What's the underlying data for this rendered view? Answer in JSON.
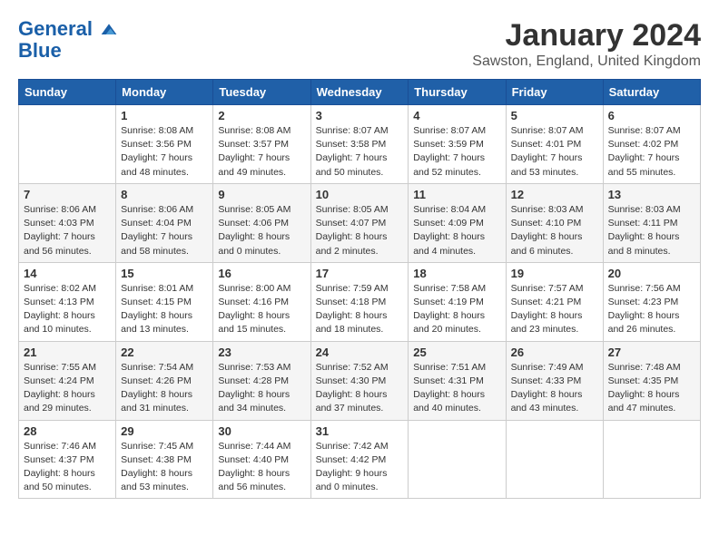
{
  "header": {
    "logo_line1": "General",
    "logo_line2": "Blue",
    "month_title": "January 2024",
    "location": "Sawston, England, United Kingdom"
  },
  "days_of_week": [
    "Sunday",
    "Monday",
    "Tuesday",
    "Wednesday",
    "Thursday",
    "Friday",
    "Saturday"
  ],
  "weeks": [
    [
      {
        "day": "",
        "sunrise": "",
        "sunset": "",
        "daylight": ""
      },
      {
        "day": "1",
        "sunrise": "Sunrise: 8:08 AM",
        "sunset": "Sunset: 3:56 PM",
        "daylight": "Daylight: 7 hours and 48 minutes."
      },
      {
        "day": "2",
        "sunrise": "Sunrise: 8:08 AM",
        "sunset": "Sunset: 3:57 PM",
        "daylight": "Daylight: 7 hours and 49 minutes."
      },
      {
        "day": "3",
        "sunrise": "Sunrise: 8:07 AM",
        "sunset": "Sunset: 3:58 PM",
        "daylight": "Daylight: 7 hours and 50 minutes."
      },
      {
        "day": "4",
        "sunrise": "Sunrise: 8:07 AM",
        "sunset": "Sunset: 3:59 PM",
        "daylight": "Daylight: 7 hours and 52 minutes."
      },
      {
        "day": "5",
        "sunrise": "Sunrise: 8:07 AM",
        "sunset": "Sunset: 4:01 PM",
        "daylight": "Daylight: 7 hours and 53 minutes."
      },
      {
        "day": "6",
        "sunrise": "Sunrise: 8:07 AM",
        "sunset": "Sunset: 4:02 PM",
        "daylight": "Daylight: 7 hours and 55 minutes."
      }
    ],
    [
      {
        "day": "7",
        "sunrise": "Sunrise: 8:06 AM",
        "sunset": "Sunset: 4:03 PM",
        "daylight": "Daylight: 7 hours and 56 minutes."
      },
      {
        "day": "8",
        "sunrise": "Sunrise: 8:06 AM",
        "sunset": "Sunset: 4:04 PM",
        "daylight": "Daylight: 7 hours and 58 minutes."
      },
      {
        "day": "9",
        "sunrise": "Sunrise: 8:05 AM",
        "sunset": "Sunset: 4:06 PM",
        "daylight": "Daylight: 8 hours and 0 minutes."
      },
      {
        "day": "10",
        "sunrise": "Sunrise: 8:05 AM",
        "sunset": "Sunset: 4:07 PM",
        "daylight": "Daylight: 8 hours and 2 minutes."
      },
      {
        "day": "11",
        "sunrise": "Sunrise: 8:04 AM",
        "sunset": "Sunset: 4:09 PM",
        "daylight": "Daylight: 8 hours and 4 minutes."
      },
      {
        "day": "12",
        "sunrise": "Sunrise: 8:03 AM",
        "sunset": "Sunset: 4:10 PM",
        "daylight": "Daylight: 8 hours and 6 minutes."
      },
      {
        "day": "13",
        "sunrise": "Sunrise: 8:03 AM",
        "sunset": "Sunset: 4:11 PM",
        "daylight": "Daylight: 8 hours and 8 minutes."
      }
    ],
    [
      {
        "day": "14",
        "sunrise": "Sunrise: 8:02 AM",
        "sunset": "Sunset: 4:13 PM",
        "daylight": "Daylight: 8 hours and 10 minutes."
      },
      {
        "day": "15",
        "sunrise": "Sunrise: 8:01 AM",
        "sunset": "Sunset: 4:15 PM",
        "daylight": "Daylight: 8 hours and 13 minutes."
      },
      {
        "day": "16",
        "sunrise": "Sunrise: 8:00 AM",
        "sunset": "Sunset: 4:16 PM",
        "daylight": "Daylight: 8 hours and 15 minutes."
      },
      {
        "day": "17",
        "sunrise": "Sunrise: 7:59 AM",
        "sunset": "Sunset: 4:18 PM",
        "daylight": "Daylight: 8 hours and 18 minutes."
      },
      {
        "day": "18",
        "sunrise": "Sunrise: 7:58 AM",
        "sunset": "Sunset: 4:19 PM",
        "daylight": "Daylight: 8 hours and 20 minutes."
      },
      {
        "day": "19",
        "sunrise": "Sunrise: 7:57 AM",
        "sunset": "Sunset: 4:21 PM",
        "daylight": "Daylight: 8 hours and 23 minutes."
      },
      {
        "day": "20",
        "sunrise": "Sunrise: 7:56 AM",
        "sunset": "Sunset: 4:23 PM",
        "daylight": "Daylight: 8 hours and 26 minutes."
      }
    ],
    [
      {
        "day": "21",
        "sunrise": "Sunrise: 7:55 AM",
        "sunset": "Sunset: 4:24 PM",
        "daylight": "Daylight: 8 hours and 29 minutes."
      },
      {
        "day": "22",
        "sunrise": "Sunrise: 7:54 AM",
        "sunset": "Sunset: 4:26 PM",
        "daylight": "Daylight: 8 hours and 31 minutes."
      },
      {
        "day": "23",
        "sunrise": "Sunrise: 7:53 AM",
        "sunset": "Sunset: 4:28 PM",
        "daylight": "Daylight: 8 hours and 34 minutes."
      },
      {
        "day": "24",
        "sunrise": "Sunrise: 7:52 AM",
        "sunset": "Sunset: 4:30 PM",
        "daylight": "Daylight: 8 hours and 37 minutes."
      },
      {
        "day": "25",
        "sunrise": "Sunrise: 7:51 AM",
        "sunset": "Sunset: 4:31 PM",
        "daylight": "Daylight: 8 hours and 40 minutes."
      },
      {
        "day": "26",
        "sunrise": "Sunrise: 7:49 AM",
        "sunset": "Sunset: 4:33 PM",
        "daylight": "Daylight: 8 hours and 43 minutes."
      },
      {
        "day": "27",
        "sunrise": "Sunrise: 7:48 AM",
        "sunset": "Sunset: 4:35 PM",
        "daylight": "Daylight: 8 hours and 47 minutes."
      }
    ],
    [
      {
        "day": "28",
        "sunrise": "Sunrise: 7:46 AM",
        "sunset": "Sunset: 4:37 PM",
        "daylight": "Daylight: 8 hours and 50 minutes."
      },
      {
        "day": "29",
        "sunrise": "Sunrise: 7:45 AM",
        "sunset": "Sunset: 4:38 PM",
        "daylight": "Daylight: 8 hours and 53 minutes."
      },
      {
        "day": "30",
        "sunrise": "Sunrise: 7:44 AM",
        "sunset": "Sunset: 4:40 PM",
        "daylight": "Daylight: 8 hours and 56 minutes."
      },
      {
        "day": "31",
        "sunrise": "Sunrise: 7:42 AM",
        "sunset": "Sunset: 4:42 PM",
        "daylight": "Daylight: 9 hours and 0 minutes."
      },
      {
        "day": "",
        "sunrise": "",
        "sunset": "",
        "daylight": ""
      },
      {
        "day": "",
        "sunrise": "",
        "sunset": "",
        "daylight": ""
      },
      {
        "day": "",
        "sunrise": "",
        "sunset": "",
        "daylight": ""
      }
    ]
  ]
}
